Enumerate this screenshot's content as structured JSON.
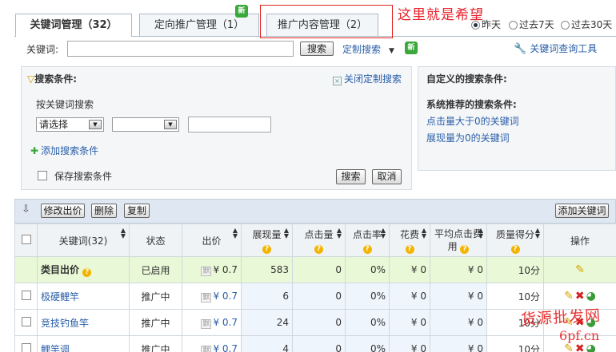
{
  "tabs": [
    {
      "label": "关键词管理（32）"
    },
    {
      "label": "定向推广管理（1）",
      "badge": "新"
    },
    {
      "label": "推广内容管理（2）"
    }
  ],
  "annotation": "这里就是希望",
  "date_range": {
    "options": [
      "昨天",
      "过去7天",
      "过去30天"
    ],
    "selected": "昨天"
  },
  "search_bar": {
    "label": "关键词:",
    "value": "",
    "search_button": "搜索",
    "custom_search": "定制搜索",
    "badge": "新",
    "tool_link": "关键词查询工具"
  },
  "filter_panel": {
    "title": "搜索条件:",
    "close_link": "关闭定制搜索",
    "subtitle": "按关键词搜索",
    "select1": "请选择",
    "select2": "",
    "text_value": "",
    "add_condition": "添加搜索条件",
    "save_label": "保存搜索条件",
    "search_button": "搜索",
    "cancel_button": "取消"
  },
  "custom_panel": {
    "title": "自定义的搜索条件:",
    "recommended_title": "系统推荐的搜索条件:",
    "links": [
      "点击量大于0的关键词",
      "展现量为0的关键词"
    ]
  },
  "toolbar": {
    "buttons": [
      "修改出价",
      "删除",
      "复制"
    ],
    "add_keyword": "添加关键词"
  },
  "table": {
    "headers": [
      "关键词(32)",
      "状态",
      "出价",
      "展现量",
      "点击量",
      "点击率",
      "花费",
      "平均点击费用",
      "质量得分",
      "操作"
    ],
    "rows": [
      {
        "keyword": "类目出价",
        "status": "已启用",
        "badge": "默",
        "bid": "¥ 0.7",
        "impressions": "583",
        "clicks": "0",
        "ctr": "0%",
        "cost": "¥ 0",
        "avg": "¥ 0",
        "score": "10分"
      },
      {
        "keyword": "极硬鲤竿",
        "status": "推广中",
        "badge": "默",
        "bid": "¥ 0.7",
        "impressions": "6",
        "clicks": "0",
        "ctr": "0%",
        "cost": "¥ 0",
        "avg": "¥ 0",
        "score": "10分"
      },
      {
        "keyword": "竞技钓鱼竿",
        "status": "推广中",
        "badge": "默",
        "bid": "¥ 0.7",
        "impressions": "24",
        "clicks": "0",
        "ctr": "0%",
        "cost": "¥ 0",
        "avg": "¥ 0",
        "score": "10分"
      },
      {
        "keyword": "鲤竿调",
        "status": "推广中",
        "badge": "默",
        "bid": "¥ 0.7",
        "impressions": "4",
        "clicks": "0",
        "ctr": "0%",
        "cost": "¥ 0",
        "avg": "¥ 0",
        "score": "10分"
      }
    ]
  },
  "watermark": {
    "line1": "货源批发网",
    "line2": "6pf.cn"
  },
  "colors": {
    "accent_red": "#e02020",
    "link_blue": "#2a5ea8",
    "category_row": "#e9f8d6",
    "metric_cell": "#eef5fd"
  }
}
